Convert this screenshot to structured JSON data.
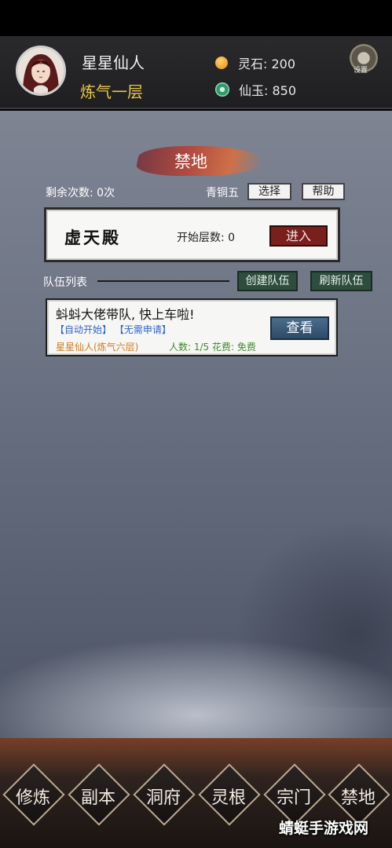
{
  "header": {
    "player_name": "星星仙人",
    "realm": "炼气一层",
    "resources": [
      {
        "icon": "spirit-stone-icon",
        "label": "灵石: 200"
      },
      {
        "icon": "jade-icon",
        "label": "仙玉: 850"
      }
    ],
    "settings_label": "设置"
  },
  "page": {
    "title": "禁地",
    "remaining": "剩余次数: 0次",
    "tier": "青铜五",
    "select_label": "选择",
    "help_label": "帮助"
  },
  "dungeon": {
    "name": "虚天殿",
    "start_floor": "开始层数: 0",
    "enter_label": "进入"
  },
  "team_list": {
    "label": "队伍列表",
    "create_label": "创建队伍",
    "refresh_label": "刷新队伍",
    "teams": [
      {
        "title": "蚪蚪大佬带队, 快上车啦!",
        "tags": "【自动开始】 【无需申请】",
        "leader": "星星仙人(炼气六层)",
        "count_cost": "人数: 1/5   花费: 免费",
        "view_label": "查看"
      }
    ]
  },
  "bottom_nav": [
    "修炼",
    "副本",
    "洞府",
    "灵根",
    "宗门",
    "禁地"
  ],
  "watermark": "蜻蜓手游戏网"
}
